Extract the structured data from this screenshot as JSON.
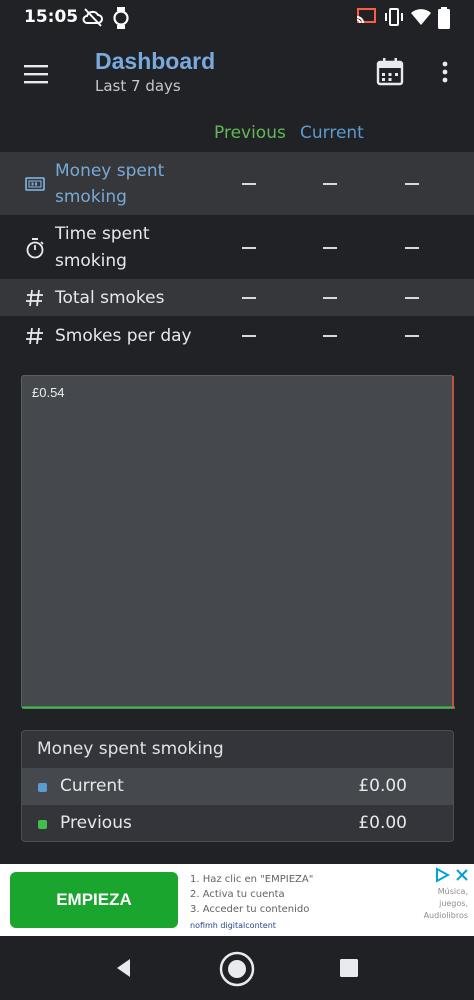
{
  "status_bar": {
    "time": "15:05",
    "icons": [
      "cloud-off-icon",
      "watch-icon",
      "cast-icon",
      "vibrate-icon",
      "wifi-icon",
      "battery-icon"
    ]
  },
  "app_bar": {
    "title": "Dashboard",
    "subtitle": "Last 7 days",
    "icons": [
      "menu-icon",
      "calendar-icon",
      "more-vert-icon"
    ]
  },
  "columns": {
    "previous": "Previous",
    "current": "Current"
  },
  "stats": [
    {
      "icon": "money-icon",
      "label_line1": "Money spent",
      "label_line2": "smoking",
      "values": [
        "—",
        "—",
        "—"
      ],
      "selected": true
    },
    {
      "icon": "stopwatch-icon",
      "label_line1": "Time spent",
      "label_line2": "smoking",
      "values": [
        "—",
        "—",
        "—"
      ],
      "selected": false
    },
    {
      "icon": "hash-icon",
      "label_line1": "Total smokes",
      "label_line2": "",
      "values": [
        "—",
        "—",
        "—"
      ],
      "selected": false
    },
    {
      "icon": "hash-icon",
      "label_line1": "Smokes per day",
      "label_line2": "",
      "values": [
        "—",
        "—",
        "—"
      ],
      "selected": false
    }
  ],
  "chart": {
    "y_tick_label": "£0.54",
    "colors": {
      "current": "#5b9bd0",
      "previous": "#3fbf4a",
      "marker": "#e0533f"
    }
  },
  "legend": {
    "title": "Money spent smoking",
    "items": [
      {
        "name": "Current",
        "value": "£0.00",
        "color": "#5b9bd0"
      },
      {
        "name": "Previous",
        "value": "£0.00",
        "color": "#3fbf4a"
      }
    ]
  },
  "ad": {
    "button_label": "EMPIEZA",
    "step1": "1. Haz clic en \"EMPIEZA\"",
    "step2": "2. Activa tu cuenta",
    "step3": "3. Acceder tu contenido",
    "brand": "nofimh digitalcontent",
    "side_line1": "Música,",
    "side_line2": "juegos,",
    "side_line3": "Audiolibros"
  },
  "nav_bar": {
    "icons": [
      "back-icon",
      "home-icon",
      "recents-icon"
    ]
  }
}
